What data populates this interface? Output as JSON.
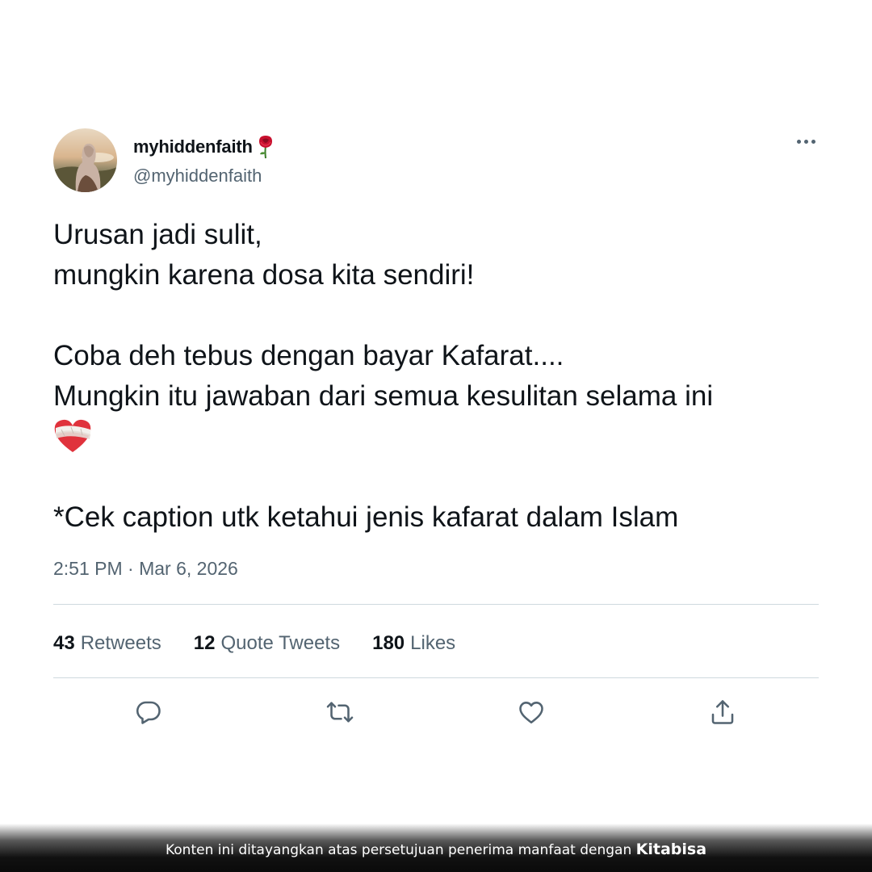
{
  "tweet": {
    "display_name": "myhiddenfaith",
    "name_emoji": "rose-icon",
    "handle": "@myhiddenfaith",
    "more_icon": "more-horizontal-icon",
    "lines": [
      "Urusan jadi sulit,",
      "mungkin karena dosa kita sendiri!",
      "Coba deh tebus dengan bayar Kafarat....",
      "Mungkin itu jawaban dari semua kesulitan selama ini",
      "*Cek caption utk ketahui jenis kafarat dalam Islam"
    ],
    "line_emoji": "mended-heart-icon",
    "timestamp": "2:51 PM · Mar 6, 2026"
  },
  "stats": {
    "retweets_count": "43",
    "retweets_label": "Retweets",
    "quotes_count": "12",
    "quotes_label": "Quote Tweets",
    "likes_count": "180",
    "likes_label": "Likes"
  },
  "actions": [
    "reply-icon",
    "retweet-icon",
    "like-icon",
    "share-icon"
  ],
  "footer": {
    "text": "Konten ini ditayangkan atas persetujuan penerima manfaat dengan",
    "brand": "Kitabisa"
  },
  "colors": {
    "text": "#0f1419",
    "secondary": "#536471",
    "divider": "#cfd9de",
    "heart_red": "#e0323c"
  }
}
